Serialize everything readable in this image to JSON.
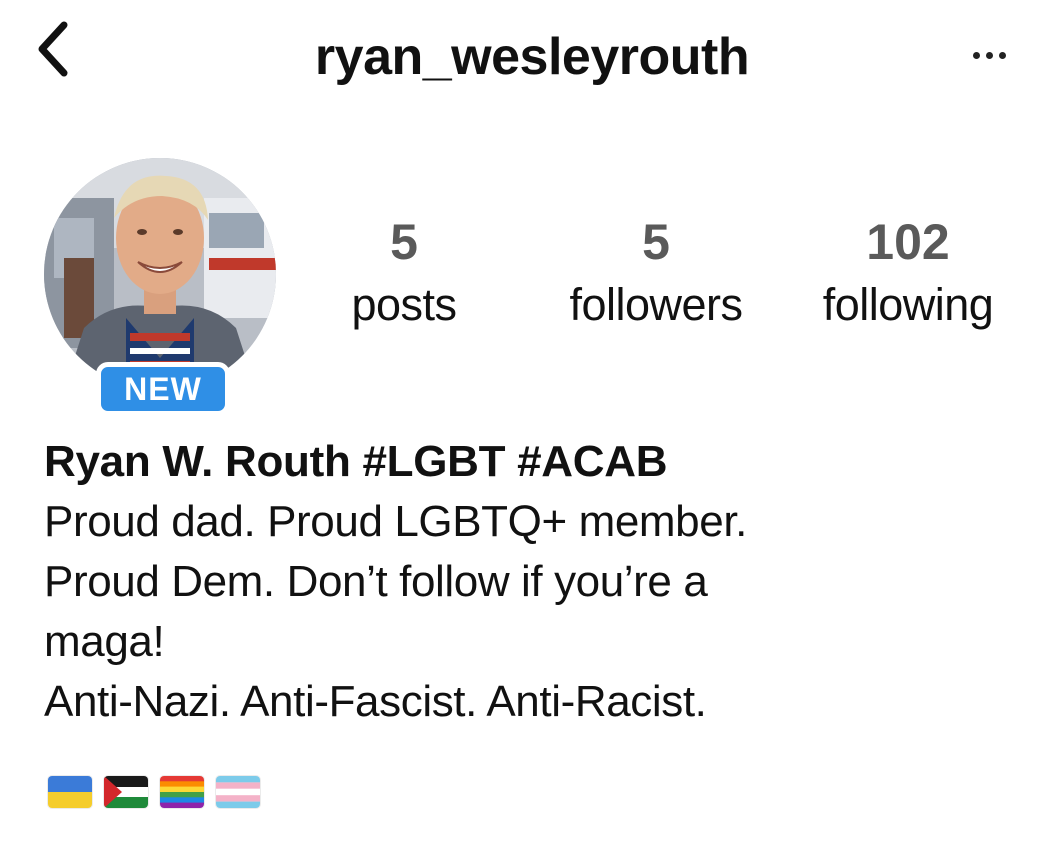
{
  "header": {
    "username": "ryan_wesleyrouth",
    "back_icon": "chevron-left-icon",
    "more_icon": "more-horizontal-icon"
  },
  "profile": {
    "badge": "NEW",
    "stats": {
      "posts_count": "5",
      "posts_label": "posts",
      "followers_count": "5",
      "followers_label": "followers",
      "following_count": "102",
      "following_label": "following"
    }
  },
  "bio": {
    "name": "Ryan W. Routh #LGBT #ACAB",
    "lines": [
      "Proud dad. Proud LGBTQ+ member.",
      "Proud Dem. Don’t follow if you’re a",
      "maga!",
      "Anti-Nazi. Anti-Fascist. Anti-Racist."
    ],
    "flags": [
      "ukraine-flag",
      "palestine-flag",
      "rainbow-pride-flag",
      "transgender-pride-flag"
    ]
  },
  "colors": {
    "badge_blue": "#2f8fe6",
    "count_gray": "#5a5a5a",
    "text": "#111111"
  }
}
